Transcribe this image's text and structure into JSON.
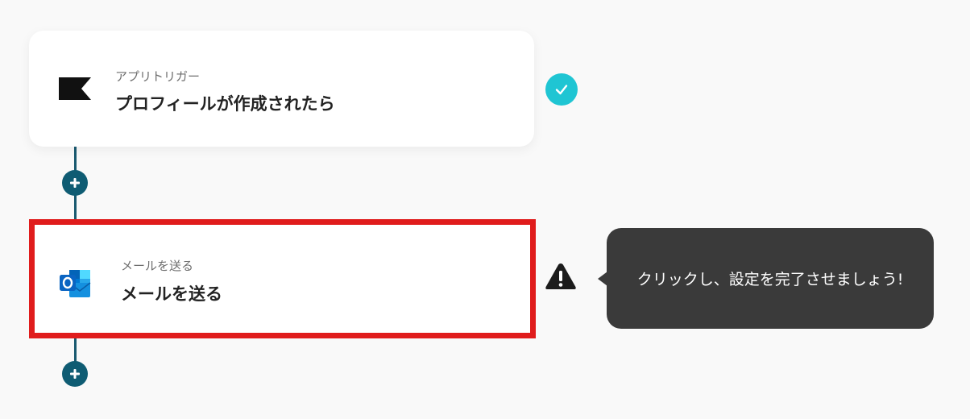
{
  "flow": {
    "trigger": {
      "subtitle": "アプリトリガー",
      "title": "プロフィールが作成されたら",
      "icon": "flag-icon",
      "status": "completed"
    },
    "action": {
      "subtitle": "メールを送る",
      "title": "メールを送る",
      "icon": "outlook-icon",
      "status": "warning"
    }
  },
  "tooltip": {
    "text": "クリックし、設定を完了させましょう!"
  },
  "colors": {
    "background": "#f9f9f9",
    "connector": "#1a5a70",
    "add_button": "#0f5c73",
    "check_badge": "#1fc5d3",
    "highlight_border": "#e01c1c",
    "tooltip_bg": "#3a3a3a"
  }
}
